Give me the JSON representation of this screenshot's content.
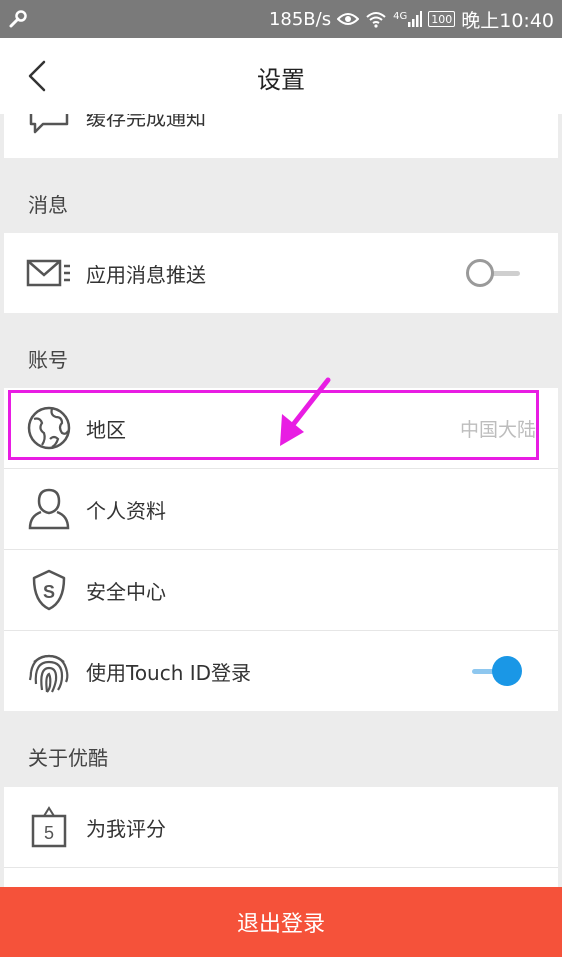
{
  "status_bar": {
    "speed": "185B/s",
    "network": "4G",
    "battery": "100",
    "time": "晚上10:40"
  },
  "header": {
    "title": "设置"
  },
  "settings": {
    "top_item": {
      "label": "缓存完成通知",
      "icon": "chat-bubble-icon"
    },
    "sections": [
      {
        "title": "消息",
        "items": [
          {
            "label": "应用消息推送",
            "icon": "mail-icon",
            "control": "toggle",
            "toggle_on": false
          }
        ]
      },
      {
        "title": "账号",
        "items": [
          {
            "label": "地区",
            "value": "中国大陆",
            "icon": "globe-icon",
            "highlighted": true
          },
          {
            "label": "个人资料",
            "icon": "person-icon"
          },
          {
            "label": "安全中心",
            "icon": "shield-icon"
          },
          {
            "label": "使用Touch ID登录",
            "icon": "fingerprint-icon",
            "control": "toggle",
            "toggle_on": true
          }
        ]
      },
      {
        "title": "关于优酷",
        "items": [
          {
            "label": "为我评分",
            "icon": "rating-icon"
          }
        ]
      }
    ]
  },
  "footer": {
    "logout_label": "退出登录"
  },
  "colors": {
    "highlight": "#e81de3",
    "toggle_on": "#1a97e6",
    "logout_bg": "#f5523a",
    "status_bar": "#7a7a7a"
  }
}
